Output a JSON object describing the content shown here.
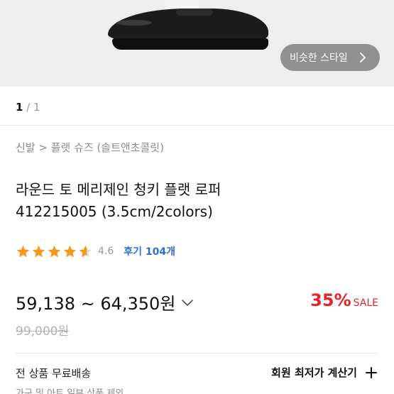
{
  "hero": {
    "similar_style_label": "비슷한 스타일"
  },
  "pager": {
    "current": "1",
    "separator": " / ",
    "total": "1"
  },
  "breadcrumb": {
    "text": "신발 > 플랫 슈즈 (솔트앤초콜릿)"
  },
  "product": {
    "title": "라운드 토 메리제인 청키 플랫 로퍼",
    "code": "412215005 (3.5cm/2colors)"
  },
  "rating": {
    "value": "4.6",
    "stars": 4.6,
    "review_label": "후기 104개"
  },
  "price": {
    "range": "59,138 ~ 64,350원",
    "discount_pct": "35%",
    "sale_label": "SALE",
    "original": "99,000원"
  },
  "shipping": {
    "label": "전 상품 무료배송",
    "sub": "가구 및 아트 일부 상품 제외"
  },
  "member": {
    "label": "회원 최저가 계산기"
  },
  "colors": {
    "accent_red": "#e3262c",
    "link_blue": "#2d6fd8",
    "star_orange": "#f39a1f"
  }
}
